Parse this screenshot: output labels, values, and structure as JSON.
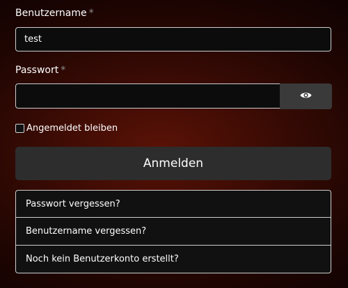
{
  "form": {
    "username": {
      "label": "Benutzername",
      "required_marker": "*",
      "value": "test"
    },
    "password": {
      "label": "Passwort",
      "required_marker": "*",
      "value": "",
      "toggle_icon": "eye-icon"
    },
    "remember_me": {
      "label": "Angemeldet bleiben",
      "checked": false
    },
    "submit_label": "Anmelden"
  },
  "links": [
    {
      "label": "Passwort vergessen?"
    },
    {
      "label": "Benutzername vergessen?"
    },
    {
      "label": "Noch kein Benutzerkonto erstellt?"
    }
  ],
  "colors": {
    "background": "#3a0b04",
    "input_background": "#0c0c0c",
    "button_background": "#2d2d2d",
    "border": "#cfcfcf"
  }
}
